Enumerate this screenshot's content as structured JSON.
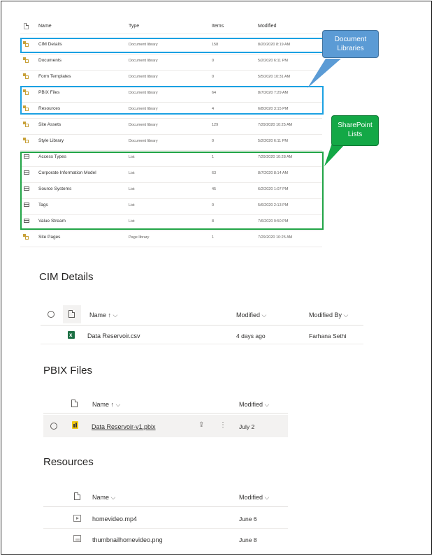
{
  "table": {
    "headers": {
      "name": "Name",
      "type": "Type",
      "items": "Items",
      "modified": "Modified"
    },
    "rows": [
      {
        "name": "CIM Details",
        "type": "Document library",
        "items": "158",
        "modified": "8/20/2020 8:19 AM",
        "icon": "library-icon"
      },
      {
        "name": "Documents",
        "type": "Document library",
        "items": "0",
        "modified": "5/2/2020 6:11 PM",
        "icon": "library-icon"
      },
      {
        "name": "Form Templates",
        "type": "Document library",
        "items": "0",
        "modified": "5/5/2020 10:31 AM",
        "icon": "library-icon"
      },
      {
        "name": "PBIX Files",
        "type": "Document library",
        "items": "64",
        "modified": "8/7/2020 7:29 AM",
        "icon": "library-icon"
      },
      {
        "name": "Resources",
        "type": "Document library",
        "items": "4",
        "modified": "6/8/2020 3:15 PM",
        "icon": "library-icon"
      },
      {
        "name": "Site Assets",
        "type": "Document library",
        "items": "129",
        "modified": "7/29/2020 10:25 AM",
        "icon": "library-icon"
      },
      {
        "name": "Style Library",
        "type": "Document library",
        "items": "0",
        "modified": "5/2/2020 6:11 PM",
        "icon": "library-icon"
      },
      {
        "name": "Access Types",
        "type": "List",
        "items": "1",
        "modified": "7/29/2020 10:28 AM",
        "icon": "list-icon"
      },
      {
        "name": "Corporate Information Model",
        "type": "List",
        "items": "63",
        "modified": "8/7/2020 8:14 AM",
        "icon": "list-icon"
      },
      {
        "name": "Source Systems",
        "type": "List",
        "items": "45",
        "modified": "6/2/2020 1:07 PM",
        "icon": "list-icon"
      },
      {
        "name": "Tags",
        "type": "List",
        "items": "0",
        "modified": "5/6/2020 2:13 PM",
        "icon": "list-icon"
      },
      {
        "name": "Value Stream",
        "type": "List",
        "items": "8",
        "modified": "7/6/2020 9:50 PM",
        "icon": "list-icon"
      },
      {
        "name": "Site Pages",
        "type": "Page library",
        "items": "1",
        "modified": "7/29/2020 10:25 AM",
        "icon": "library-icon"
      }
    ]
  },
  "callouts": {
    "doc_libraries": [
      "Document",
      "Libraries"
    ],
    "sp_lists": [
      "SharePoint",
      "Lists"
    ],
    "colors": {
      "blue": "#1ba1e2",
      "green": "#21a446",
      "blue_fill": "#5b9bd5",
      "green_fill": "#13a846"
    }
  },
  "cim": {
    "title": "CIM Details",
    "headers": {
      "name": "Name ↑",
      "modified": "Modified",
      "modified_by": "Modified By"
    },
    "row": {
      "name": "Data Reservoir.csv",
      "modified": "4 days ago",
      "modified_by": "Farhana Sethi"
    }
  },
  "pbix": {
    "title": "PBIX Files",
    "headers": {
      "name": "Name ↑",
      "modified": "Modified"
    },
    "row": {
      "name": "Data Reservoir-v1.pbix",
      "modified": "July 2"
    }
  },
  "resources": {
    "title": "Resources",
    "headers": {
      "name": "Name",
      "modified": "Modified"
    },
    "rows": [
      {
        "name": "homevideo.mp4",
        "modified": "June 6"
      },
      {
        "name": "thumbnailhomevideo.png",
        "modified": "June 8"
      }
    ]
  }
}
